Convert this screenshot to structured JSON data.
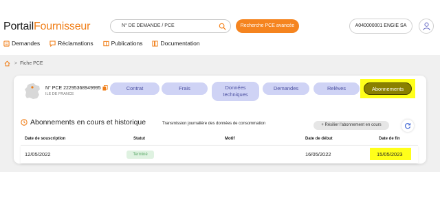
{
  "logo": {
    "part1": "Portail",
    "part2": "Fournisseur"
  },
  "search": {
    "placeholder": "N° DE DEMANDE / PCE"
  },
  "advanced_search_label": "Recherche PCE avancée",
  "account_label": "A040000001 ENGIE SA",
  "nav": [
    {
      "label": "Demandes",
      "icon": "demandes-icon"
    },
    {
      "label": "Réclamations",
      "icon": "reclamations-icon"
    },
    {
      "label": "Publications",
      "icon": "publications-icon"
    },
    {
      "label": "Documentation",
      "icon": "documentation-icon"
    }
  ],
  "breadcrumb": {
    "separator": ">",
    "current": "Fiche PCE"
  },
  "pce": {
    "label": "N° PCE 22295368949995",
    "region": "ILE DE FRANCE"
  },
  "tabs": [
    {
      "label": "Contrat"
    },
    {
      "label": "Frais"
    },
    {
      "label_line1": "Données",
      "label_line2": "techniques"
    },
    {
      "label": "Demandes"
    },
    {
      "label": "Relèves"
    },
    {
      "label": "Abonnements"
    }
  ],
  "section": {
    "title": "Abonnements en cours et historique",
    "subtitle": "Transmission journalière des données de consommation",
    "resilier_label": "+ Résilier l'abonnement en cours"
  },
  "table": {
    "headers": [
      "Date de souscription",
      "Statut",
      "Motif",
      "Date de début",
      "Date de fin"
    ],
    "rows": [
      {
        "date_souscription": "12/05/2022",
        "statut": "Terminé",
        "motif": "",
        "date_debut": "16/05/2022",
        "date_fin": "15/05/2023"
      }
    ]
  },
  "colors": {
    "accent": "#f5841f",
    "tab_bg": "#cfd3f5",
    "tab_active": "#8a8000",
    "highlight": "#ffff1a",
    "status_green": "#5aa867"
  }
}
